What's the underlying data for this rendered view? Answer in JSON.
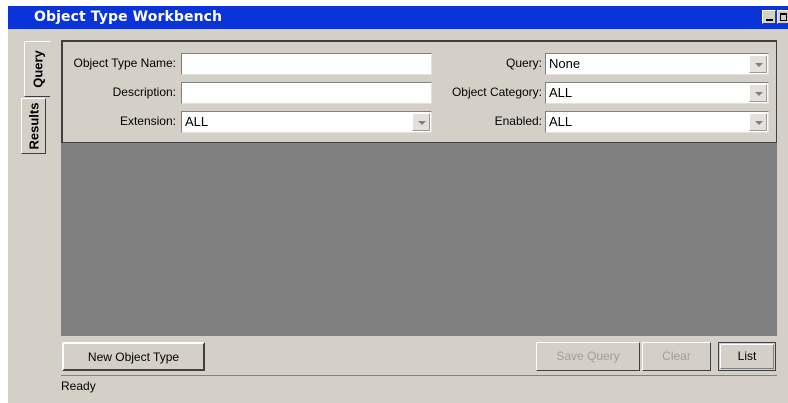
{
  "window": {
    "title": "Object Type Workbench"
  },
  "tabs": [
    {
      "label": "Query",
      "active": true
    },
    {
      "label": "Results",
      "active": false
    }
  ],
  "query_form": {
    "object_type_name": {
      "label": "Object Type Name:",
      "value": ""
    },
    "description": {
      "label": "Description:",
      "value": ""
    },
    "extension": {
      "label": "Extension:",
      "value": "ALL"
    },
    "query": {
      "label": "Query:",
      "value": "None"
    },
    "object_category": {
      "label": "Object Category:",
      "value": "ALL"
    },
    "enabled": {
      "label": "Enabled:",
      "value": "ALL"
    }
  },
  "buttons": {
    "new_object_type": "New Object Type",
    "save_query": "Save Query",
    "clear": "Clear",
    "list": "List"
  },
  "status": {
    "text": "Ready"
  },
  "colors": {
    "titlebar": "#0a33d8",
    "window_bg": "#d4d0c8",
    "results_bg": "#808080"
  }
}
